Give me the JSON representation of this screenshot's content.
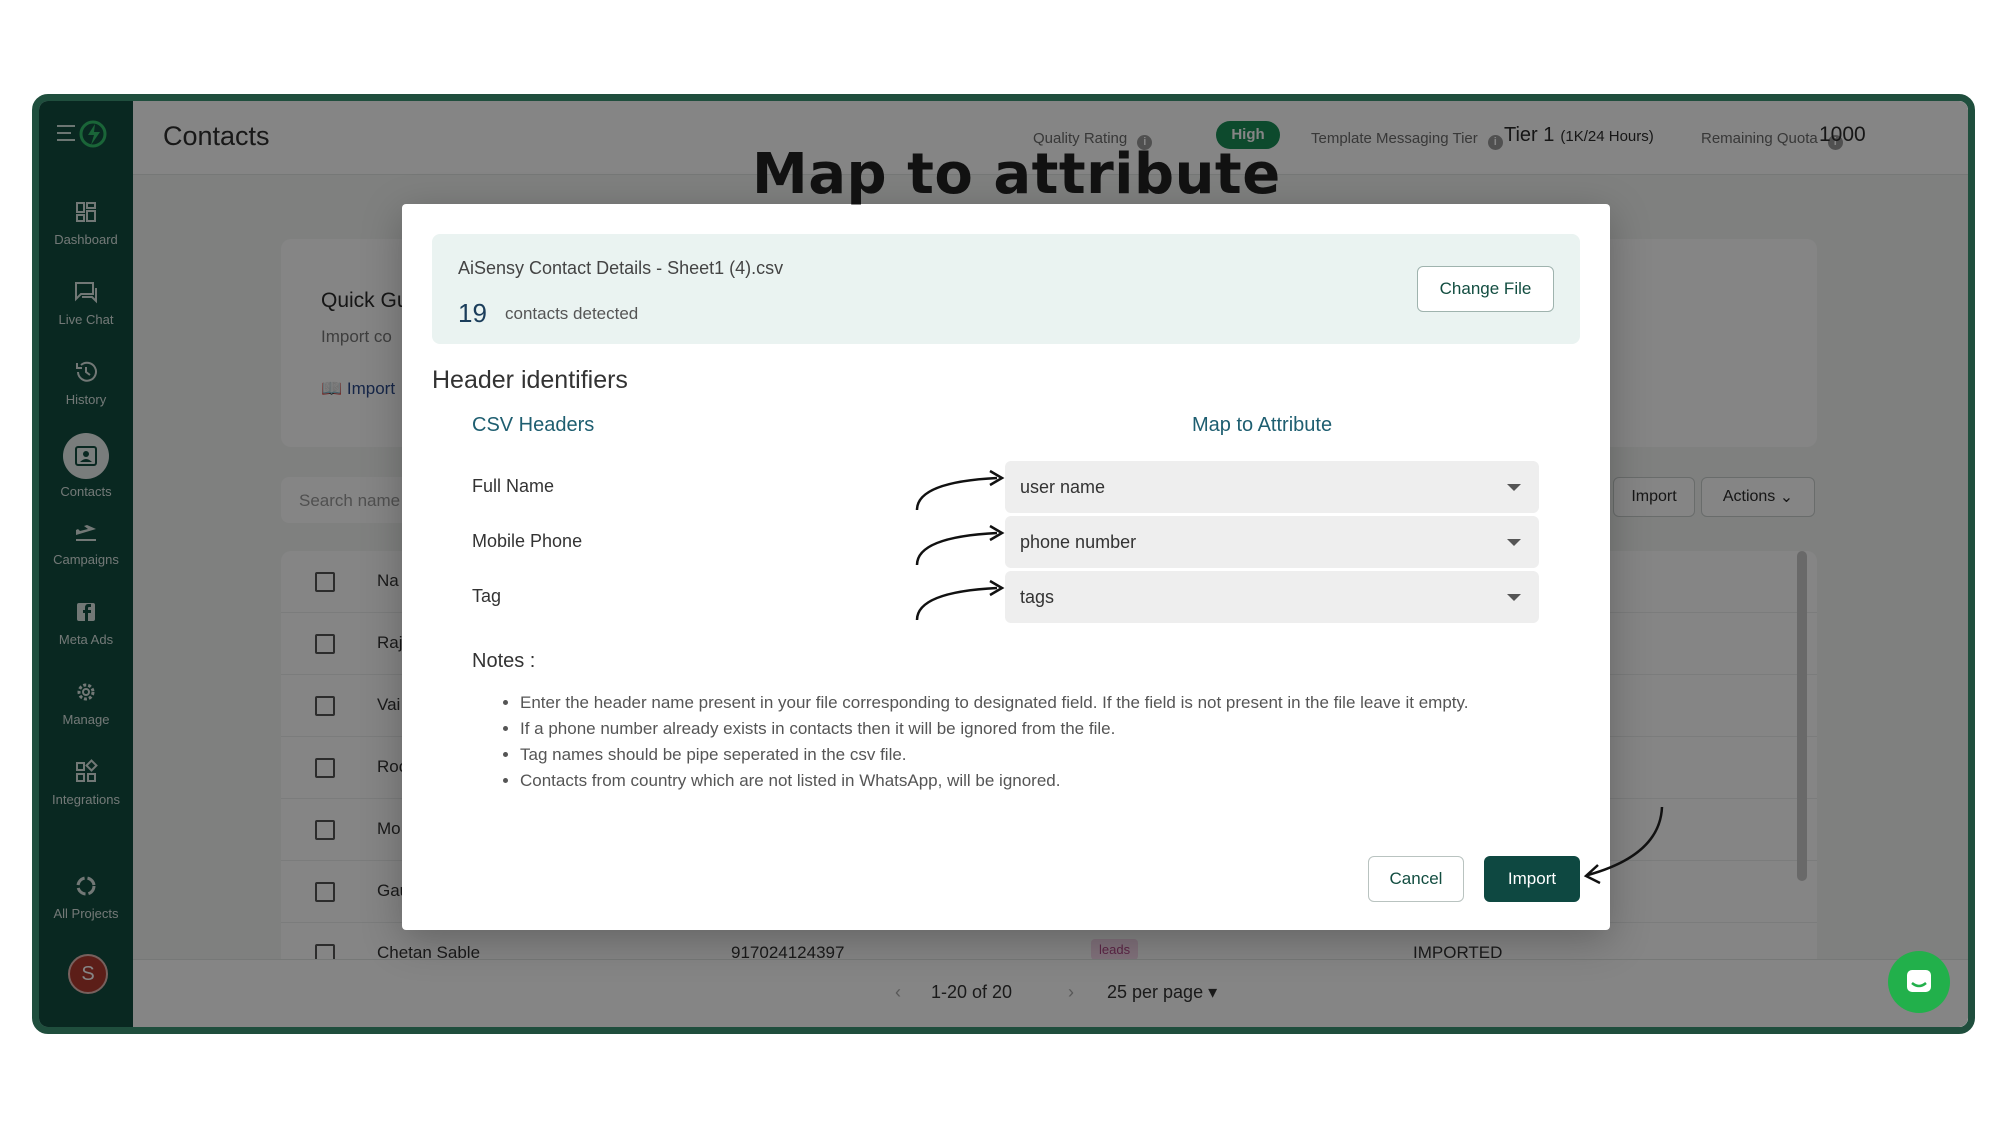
{
  "overlay_title": "Map to attribute",
  "header": {
    "title": "Contacts",
    "quality_rating_label": "Quality Rating",
    "quality_rating_value": "High",
    "tier_label": "Template Messaging Tier",
    "tier_value": "Tier 1",
    "tier_detail": "(1K/24 Hours)",
    "quota_label": "Remaining Quota",
    "quota_value": "1000",
    "info_icon": "i"
  },
  "sidebar": {
    "items": [
      {
        "label": "Dashboard",
        "icon": "grid-icon"
      },
      {
        "label": "Live Chat",
        "icon": "chat-icon"
      },
      {
        "label": "History",
        "icon": "history-icon"
      },
      {
        "label": "Contacts",
        "icon": "contacts-icon"
      },
      {
        "label": "Campaigns",
        "icon": "plane-icon"
      },
      {
        "label": "Meta Ads",
        "icon": "facebook-icon"
      },
      {
        "label": "Manage",
        "icon": "gear-icon"
      },
      {
        "label": "Integrations",
        "icon": "integrations-icon"
      },
      {
        "label": "All Projects",
        "icon": "projects-icon"
      }
    ],
    "avatar_letter": "S"
  },
  "background": {
    "guide_title": "Quick Gu",
    "guide_sub": "Import co",
    "guide_link": "Import",
    "search_placeholder": "Search name",
    "import_label": "Import",
    "actions_label": "Actions",
    "rows": [
      {
        "name": "Na"
      },
      {
        "name": "Raj"
      },
      {
        "name": "Vai"
      },
      {
        "name": "Roc"
      },
      {
        "name": "Mo"
      },
      {
        "name": "Gau"
      },
      {
        "name": "Chetan Sable",
        "phone": "917024124397",
        "tag": "leads",
        "status": "IMPORTED"
      }
    ],
    "pager": {
      "range": "1-20 of 20",
      "per_page": "25 per page"
    }
  },
  "modal": {
    "file_name": "AiSensy Contact Details - Sheet1 (4).csv",
    "count": "19",
    "count_label": "contacts detected",
    "change_file": "Change File",
    "section_title": "Header identifiers",
    "col_csv": "CSV Headers",
    "col_attr": "Map to Attribute",
    "mappings": [
      {
        "csv": "Full Name",
        "attr": "user name"
      },
      {
        "csv": "Mobile Phone",
        "attr": "phone number"
      },
      {
        "csv": "Tag",
        "attr": "tags"
      }
    ],
    "notes_title": "Notes :",
    "notes": [
      "Enter the header name present in your file corresponding to designated field. If the field is not present in the file leave it empty.",
      "If a phone number already exists in contacts then it will be ignored from the file.",
      "Tag names should be pipe seperated in the csv file.",
      "Contacts from country which are not listed in WhatsApp, will be ignored."
    ],
    "cancel": "Cancel",
    "import": "Import"
  }
}
